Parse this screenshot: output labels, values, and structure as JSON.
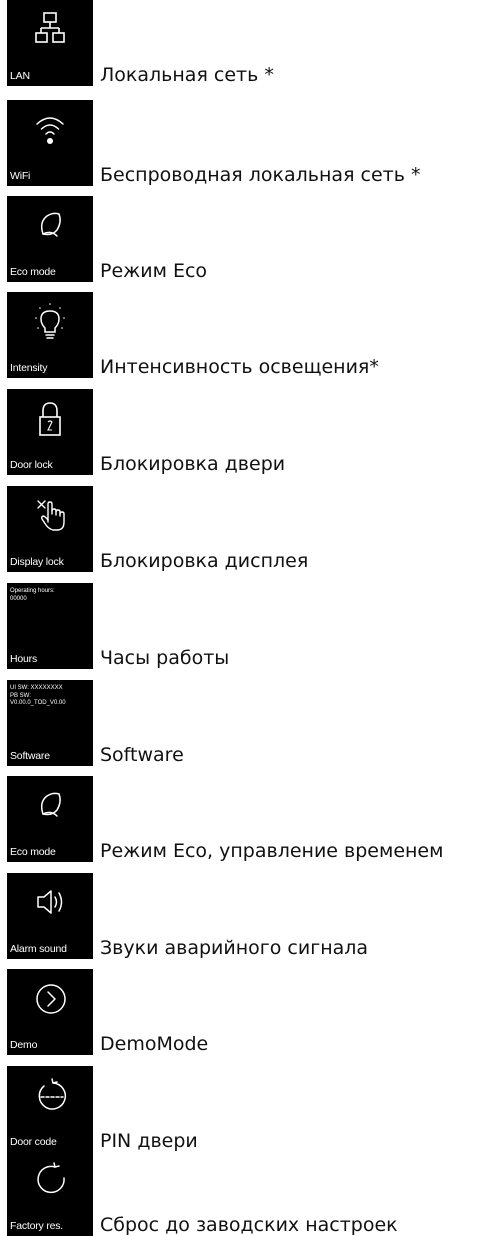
{
  "items": [
    {
      "tile": "LAN",
      "text": "Локальная сеть *",
      "icon": "lan-icon"
    },
    {
      "tile": "WiFi",
      "text": "Беспроводная локальная сеть *",
      "icon": "wifi-icon"
    },
    {
      "tile": "Eco mode",
      "text": "Режим Eco",
      "icon": "leaf-icon"
    },
    {
      "tile": "Intensity",
      "text": "Интенсивность освещения*",
      "icon": "bulb-icon"
    },
    {
      "tile": "Door lock",
      "text": "Блокировка двери",
      "icon": "padlock-icon"
    },
    {
      "tile": "Display lock",
      "text": "Блокировка дисплея",
      "icon": "touch-lock-icon"
    },
    {
      "tile": "Hours",
      "text": "Часы работы",
      "info": "Operating hours:\n00000"
    },
    {
      "tile": "Software",
      "text": "Software",
      "info": "UI SW: XXXXXXXX\nPB SW:\nV0.00.0_TOD_V0.00"
    },
    {
      "tile": "Eco mode",
      "text": "Режим Eco, управление временем",
      "icon": "leaf-icon"
    },
    {
      "tile": "Alarm sound",
      "text": "Звуки аварийного сигнала",
      "icon": "speaker-icon"
    },
    {
      "tile": "Demo",
      "text": "DemoMode",
      "icon": "play-circle-icon"
    },
    {
      "tile": "Door code",
      "text": "PIN двери",
      "icon": "door-code-icon"
    },
    {
      "tile": "Factory res.",
      "text": "Сброс до заводских настроек",
      "icon": "reset-icon"
    }
  ]
}
